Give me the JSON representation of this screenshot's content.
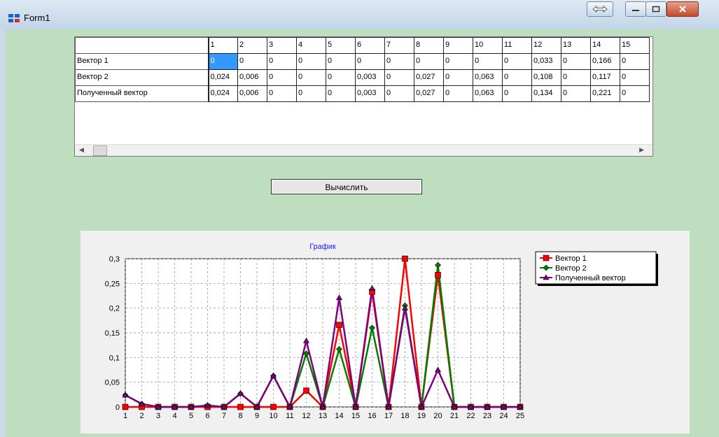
{
  "window": {
    "title": "Form1"
  },
  "grid": {
    "columns": [
      "1",
      "2",
      "3",
      "4",
      "5",
      "6",
      "7",
      "8",
      "9",
      "10",
      "11",
      "12",
      "13",
      "14",
      "15"
    ],
    "rows": [
      {
        "label": "Вектор 1",
        "cells": [
          "0",
          "0",
          "0",
          "0",
          "0",
          "0",
          "0",
          "0",
          "0",
          "0",
          "0",
          "0,033",
          "0",
          "0,166",
          "0"
        ]
      },
      {
        "label": "Вектор 2",
        "cells": [
          "0,024",
          "0,006",
          "0",
          "0",
          "0",
          "0,003",
          "0",
          "0,027",
          "0",
          "0,063",
          "0",
          "0,108",
          "0",
          "0,117",
          "0"
        ]
      },
      {
        "label": "Полученный вектор",
        "cells": [
          "0,024",
          "0,006",
          "0",
          "0",
          "0",
          "0,003",
          "0",
          "0,027",
          "0",
          "0,063",
          "0",
          "0,134",
          "0",
          "0,221",
          "0"
        ]
      }
    ]
  },
  "calculate_button": {
    "label": "Вычислить"
  },
  "chart_data": {
    "type": "line",
    "title": "График",
    "x": [
      1,
      2,
      3,
      4,
      5,
      6,
      7,
      8,
      9,
      10,
      11,
      12,
      13,
      14,
      15,
      16,
      17,
      18,
      19,
      20,
      21,
      22,
      23,
      24,
      25
    ],
    "ylim": [
      0,
      0.3
    ],
    "yticks": [
      "0",
      "0,05",
      "0,1",
      "0,15",
      "0,2",
      "0,25",
      "0,3"
    ],
    "grid": true,
    "legend_position": "top-right",
    "series": [
      {
        "name": "Вектор 1",
        "color": "#ff0000",
        "marker": "square",
        "values": [
          0,
          0,
          0,
          0,
          0,
          0,
          0,
          0,
          0,
          0,
          0,
          0.033,
          0,
          0.166,
          0,
          0.233,
          0,
          0.3,
          0,
          0.267,
          0,
          0,
          0,
          0,
          0
        ]
      },
      {
        "name": "Вектор 2",
        "color": "#008000",
        "marker": "diamond",
        "values": [
          0.024,
          0.006,
          0,
          0,
          0,
          0.003,
          0,
          0.027,
          0,
          0.063,
          0,
          0.108,
          0,
          0.117,
          0,
          0.16,
          0,
          0.205,
          0,
          0.287,
          0,
          0,
          0,
          0,
          0
        ]
      },
      {
        "name": "Полученный вектор",
        "color": "#800080",
        "marker": "triangle",
        "values": [
          0.024,
          0.006,
          0,
          0,
          0,
          0.003,
          0,
          0.027,
          0,
          0.063,
          0,
          0.134,
          0,
          0.221,
          0,
          0.24,
          0,
          0.2,
          0,
          0.075,
          0,
          0,
          0,
          0,
          0
        ]
      }
    ]
  }
}
